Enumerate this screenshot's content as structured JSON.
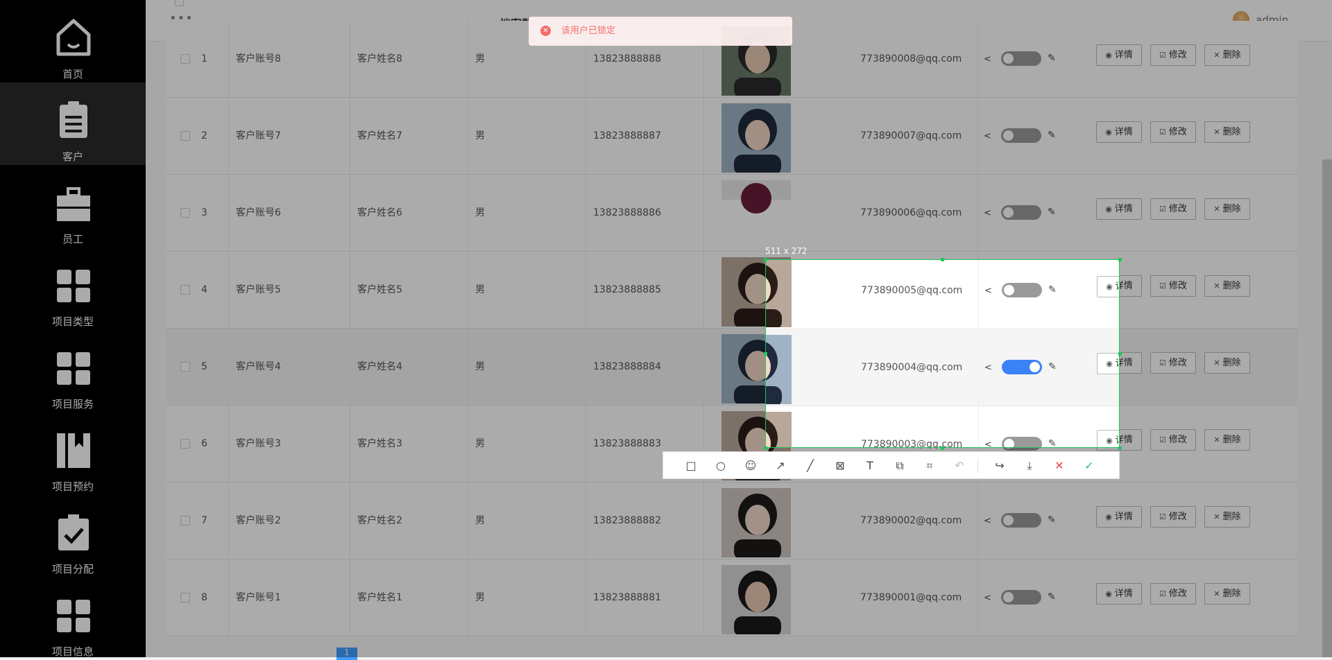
{
  "sidebar": {
    "items": [
      {
        "label": "首页",
        "icon": "home-icon"
      },
      {
        "label": "客户",
        "icon": "clipboard-icon"
      },
      {
        "label": "员工",
        "icon": "briefcase-icon"
      },
      {
        "label": "项目类型",
        "icon": "grid-icon"
      },
      {
        "label": "项目服务",
        "icon": "grid-icon"
      },
      {
        "label": "项目预约",
        "icon": "book-icon"
      },
      {
        "label": "项目分配",
        "icon": "task-check-icon"
      },
      {
        "label": "项目信息",
        "icon": "grid-icon"
      }
    ],
    "active_index": 1
  },
  "header": {
    "menu_dots": "•••",
    "page_title": "档案数",
    "username": "admin"
  },
  "toast": {
    "message": "该用户已锁定",
    "color": "#f56c6c"
  },
  "table": {
    "rows": [
      {
        "index": "1",
        "account": "客户账号8",
        "name": "客户姓名8",
        "gender": "男",
        "phone": "13823888888",
        "email": "773890008@qq.com",
        "enabled": false
      },
      {
        "index": "2",
        "account": "客户账号7",
        "name": "客户姓名7",
        "gender": "男",
        "phone": "13823888887",
        "email": "773890007@qq.com",
        "enabled": false
      },
      {
        "index": "3",
        "account": "客户账号6",
        "name": "客户姓名6",
        "gender": "男",
        "phone": "13823888886",
        "email": "773890006@qq.com",
        "enabled": false
      },
      {
        "index": "4",
        "account": "客户账号5",
        "name": "客户姓名5",
        "gender": "男",
        "phone": "13823888885",
        "email": "773890005@qq.com",
        "enabled": false
      },
      {
        "index": "5",
        "account": "客户账号4",
        "name": "客户姓名4",
        "gender": "男",
        "phone": "13823888884",
        "email": "773890004@qq.com",
        "enabled": true
      },
      {
        "index": "6",
        "account": "客户账号3",
        "name": "客户姓名3",
        "gender": "男",
        "phone": "13823888883",
        "email": "773890003@qq.com",
        "enabled": false
      },
      {
        "index": "7",
        "account": "客户账号2",
        "name": "客户姓名2",
        "gender": "男",
        "phone": "13823888882",
        "email": "773890002@qq.com",
        "enabled": false
      },
      {
        "index": "8",
        "account": "客户账号1",
        "name": "客户姓名1",
        "gender": "男",
        "phone": "13823888881",
        "email": "773890001@qq.com",
        "enabled": false
      }
    ],
    "actions": {
      "detail": "详情",
      "edit": "修改",
      "delete": "删除"
    }
  },
  "screenshot_tool": {
    "size_label": "511 x 272",
    "tools": [
      "rectangle-icon",
      "ellipse-icon",
      "emoji-icon",
      "arrow-icon",
      "line-icon",
      "mosaic-icon",
      "text-icon",
      "pin-icon",
      "ocr-icon",
      "undo-icon",
      "share-icon",
      "download-icon",
      "cancel-icon",
      "confirm-icon"
    ]
  },
  "colors": {
    "accent": "#3b82f6",
    "selection": "#22c55e",
    "sidebar_bg": "#000000"
  }
}
